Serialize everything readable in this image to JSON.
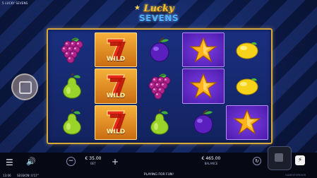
{
  "header": {
    "game_title": "5 LUCKY SEVENS"
  },
  "logo": {
    "line1": "Lucky",
    "line2": "SEVENS"
  },
  "reels": [
    [
      "grapes",
      "lucky7-wild",
      "plum",
      "star",
      "lemon"
    ],
    [
      "pear",
      "lucky7-wild",
      "grapes",
      "star",
      "lemon"
    ],
    [
      "pear",
      "lucky7-wild",
      "pear",
      "plum",
      "star"
    ]
  ],
  "highlighted": [
    [
      0,
      3
    ],
    [
      1,
      3
    ],
    [
      2,
      4
    ]
  ],
  "wild_label": "WILD",
  "bottom_bar": {
    "bet_value": "€ 35.00",
    "bet_label": "BET",
    "balance_value": "€ 465.00",
    "balance_label": "BALANCE",
    "status_text": "PLAYING FOR FUN!",
    "time": "13:06",
    "session": "SESSION: 0'17''",
    "provider": "GAMESFOREVER"
  },
  "icons": {
    "menu": "menu-icon",
    "sound": "speaker-icon",
    "minus": "minus-icon",
    "plus": "plus-icon",
    "autoplay": "autoplay-icon",
    "turbo": "lightning-icon"
  },
  "colors": {
    "frame": "#d9a93a",
    "highlight": "#7c3ee6",
    "wild": "#f7b23b"
  }
}
